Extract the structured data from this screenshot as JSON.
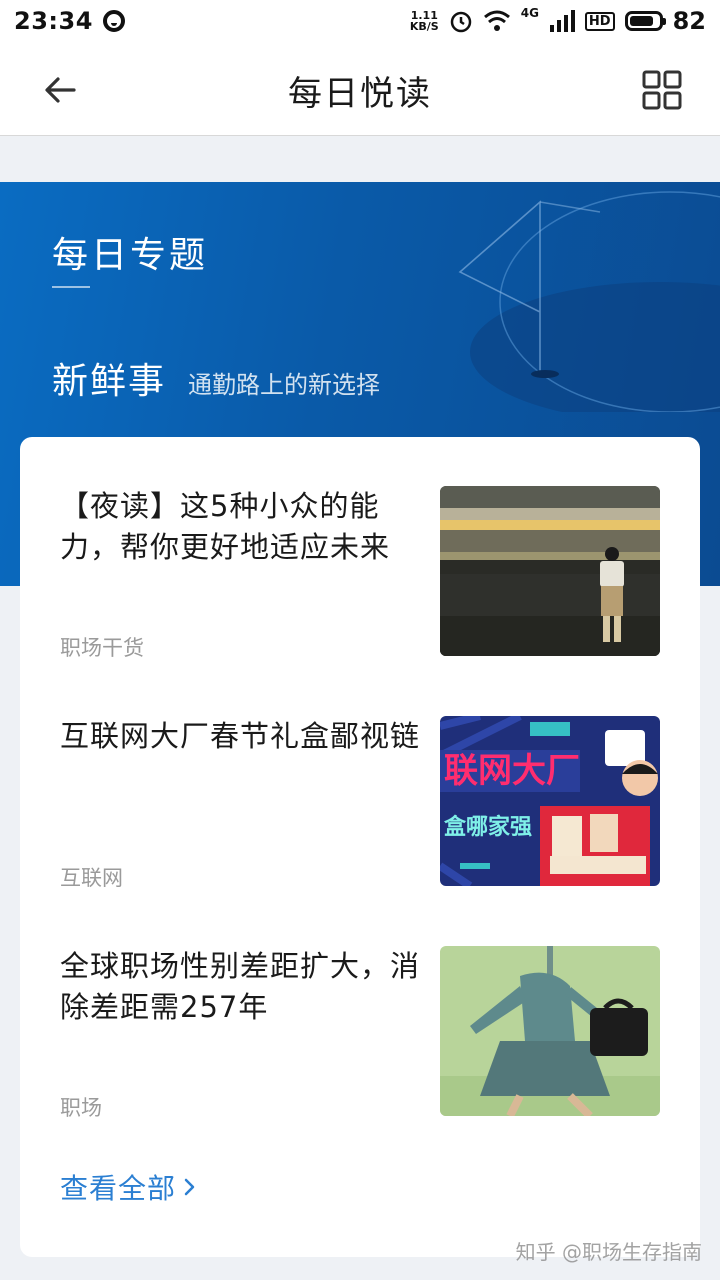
{
  "status_bar": {
    "time": "23:34",
    "net_speed_value": "1.11",
    "net_speed_unit": "KB/S",
    "network_label": "4G",
    "hd_label": "HD",
    "battery_level": "82"
  },
  "nav": {
    "title": "每日悦读",
    "back_icon": "arrow-left-icon",
    "grid_icon": "grid-icon"
  },
  "hero": {
    "title": "每日专题",
    "subtitle": "新鲜事",
    "tagline": "通勤路上的新选择",
    "colors": {
      "primary": "#0a5aa8"
    }
  },
  "articles": [
    {
      "title": "【夜读】这5种小众的能力，帮你更好地适应未来",
      "tag": "职场干货",
      "thumb_icon": "train-station-photo"
    },
    {
      "title": "互联网大厂春节礼盒鄙视链",
      "tag": "互联网",
      "thumb_icon": "gift-box-poster"
    },
    {
      "title": "全球职场性别差距扩大，消除差距需257年",
      "tag": "职场",
      "thumb_icon": "businesswoman-illustration"
    }
  ],
  "see_all": {
    "label": "查看全部",
    "icon": "chevron-right-icon",
    "color": "#2b7fd2"
  },
  "watermark": "知乎 @职场生存指南"
}
